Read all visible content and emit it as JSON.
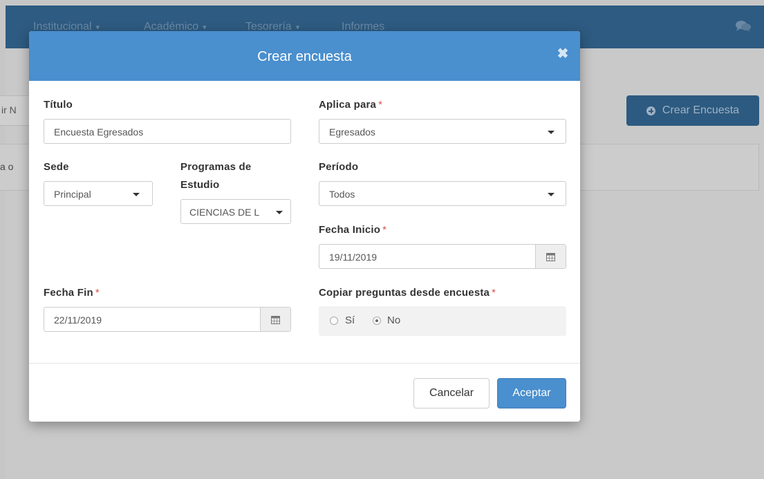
{
  "navbar": {
    "items": [
      {
        "label": "Institucional",
        "caret": "▾"
      },
      {
        "label": "Académico",
        "caret": "▾"
      },
      {
        "label": "Tesorería",
        "caret": "▾"
      },
      {
        "label": "Informes",
        "caret": ""
      }
    ],
    "chat_icon": "chat-icon"
  },
  "background": {
    "search_text": "ir N",
    "panel_text": "a o",
    "create_button_label": "Crear Encuesta"
  },
  "modal": {
    "title": "Crear encuesta",
    "close_icon": "close-icon",
    "titulo": {
      "label": "Título",
      "value": "Encuesta Egresados"
    },
    "aplica_para": {
      "label": "Aplica para",
      "required": "*",
      "value": "Egresados"
    },
    "sede": {
      "label": "Sede",
      "value": "Principal"
    },
    "programas": {
      "label_line1": "Programas de",
      "label_line2": "Estudio",
      "value": "CIENCIAS DE L"
    },
    "periodo": {
      "label": "Período",
      "value": "Todos"
    },
    "fecha_inicio": {
      "label": "Fecha Inicio",
      "required": "*",
      "value": "19/11/2019"
    },
    "fecha_fin": {
      "label": "Fecha Fin",
      "required": "*",
      "value": "22/11/2019"
    },
    "copiar": {
      "label": "Copiar preguntas desde encuesta",
      "required": "*",
      "options": [
        {
          "label": "Sí",
          "checked": false
        },
        {
          "label": "No",
          "checked": true
        }
      ]
    },
    "buttons": {
      "cancel": "Cancelar",
      "accept": "Aceptar"
    }
  },
  "colors": {
    "navbar": "#2e5b82",
    "modal_header": "#4a8fce",
    "primary_button": "#4a8fce",
    "required_mark": "#d9534f"
  }
}
